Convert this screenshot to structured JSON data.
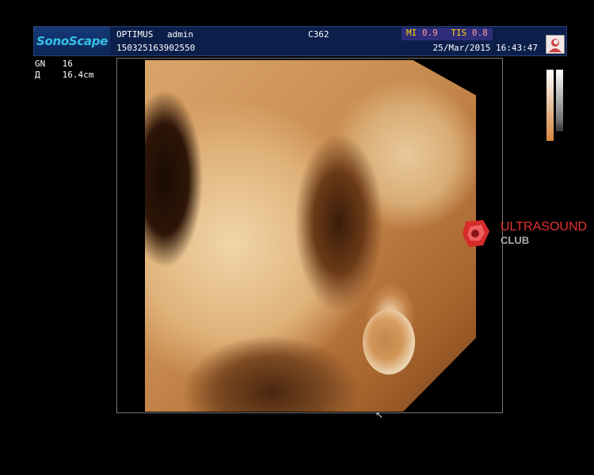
{
  "header": {
    "brand": "SonoScape",
    "hospital": "OPTIMUS",
    "operator": "admin",
    "probe": "C362",
    "mi_label": "MI",
    "mi_value": "0.9",
    "tis_label": "TIS",
    "tis_value": "0.8",
    "patient_id": "150325163902550",
    "datetime": "25/Mar/2015  16:43:47"
  },
  "params": {
    "gain_label": "GN",
    "gain_value": "16",
    "depth_label": "Д",
    "depth_value": "16.4cm"
  },
  "watermark": {
    "line1": "ULTRASOUND",
    "line2": "CLUB"
  },
  "colors": {
    "header_bg": "#0b1f4a",
    "brand_text": "#35c2e8",
    "mi_label": "#ffd400",
    "mi_value": "#ff9c9c",
    "watermark_red": "#e8322f",
    "render_tint": "#d9a56c"
  },
  "icons": {
    "patient_thumb": "person-thumbnail-icon",
    "cursor": "mouse-pointer-icon",
    "watermark_logo": "ultrasound-club-logo-icon"
  }
}
